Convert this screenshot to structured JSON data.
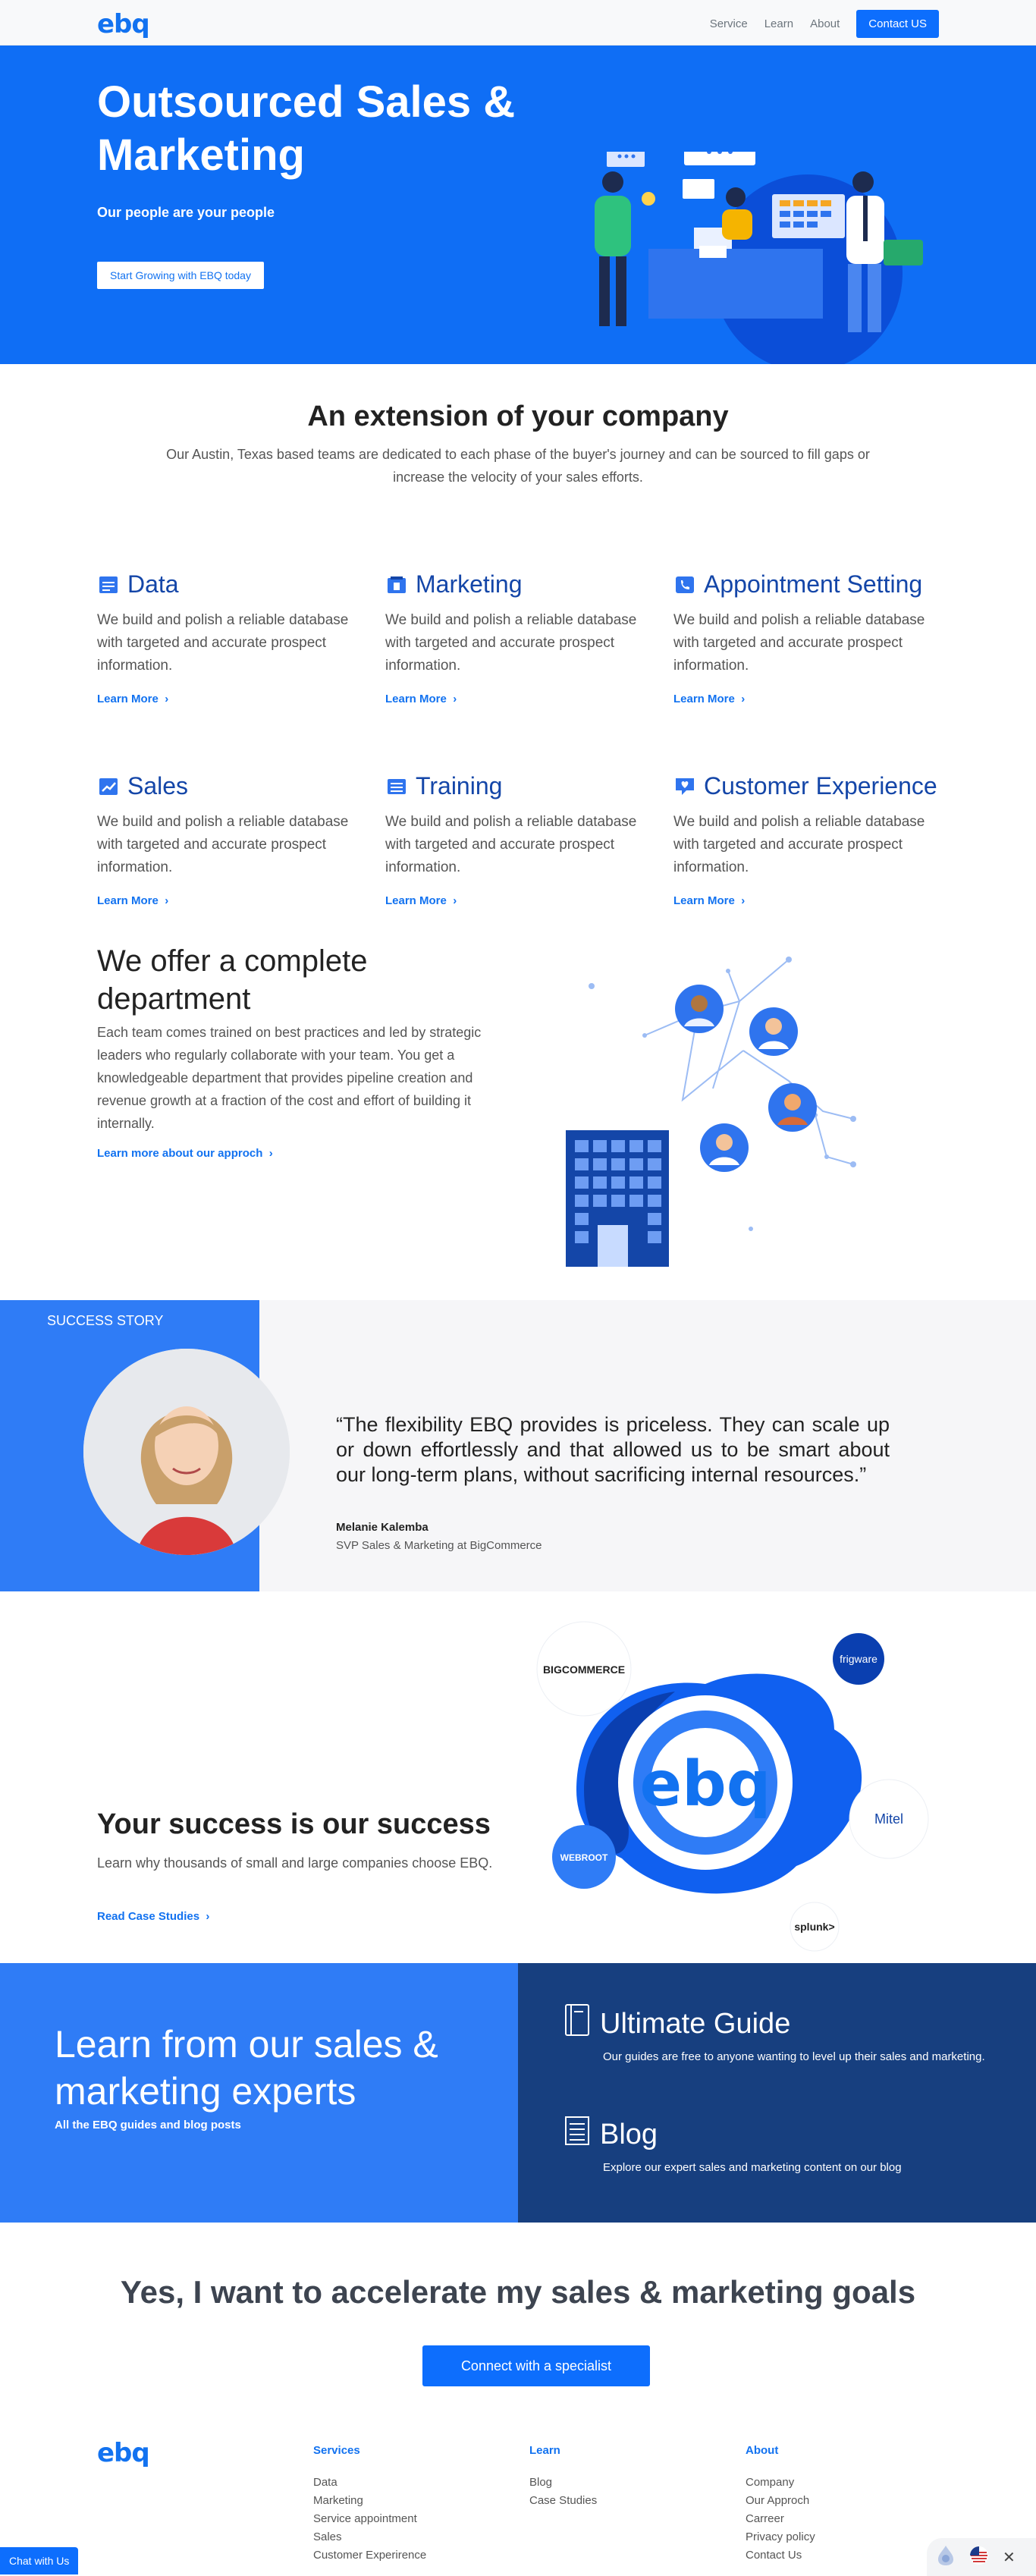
{
  "header": {
    "logo": "ebq",
    "nav": [
      "Service",
      "Learn",
      "About"
    ],
    "contact": "Contact US"
  },
  "hero": {
    "title": "Outsourced Sales & Marketing",
    "subtitle": "Our people are your people",
    "cta": "Start Growing with EBQ today"
  },
  "extension": {
    "title": "An extension of your company",
    "text": "Our Austin, Texas based teams are dedicated to each phase of the buyer's journey and can be sourced to fill gaps or increase the velocity of your sales efforts."
  },
  "services": [
    {
      "icon": "database-icon",
      "title": "Data",
      "text": "We build and polish a reliable database with targeted and accurate prospect information.",
      "link": "Learn More"
    },
    {
      "icon": "marketing-icon",
      "title": "Marketing",
      "text": "We build and polish a reliable database with targeted and accurate prospect information.",
      "link": "Learn More"
    },
    {
      "icon": "phone-icon",
      "title": "Appointment Setting",
      "text": "We build and polish a reliable database with targeted and accurate prospect information.",
      "link": "Learn More"
    },
    {
      "icon": "chart-icon",
      "title": "Sales",
      "text": "We build and polish a reliable database with targeted and accurate prospect information.",
      "link": "Learn More"
    },
    {
      "icon": "training-icon",
      "title": "Training",
      "text": "We build and polish a reliable database with targeted and accurate prospect information.",
      "link": "Learn More"
    },
    {
      "icon": "heart-chat-icon",
      "title": "Customer Experience",
      "text": "We build and polish a reliable database with targeted and accurate prospect information.",
      "link": "Learn More"
    }
  ],
  "department": {
    "title": "We offer a complete department",
    "text": "Each team comes trained on best practices and led by strategic leaders who regularly collaborate with your team. You get a knowledgeable department that provides pipeline creation and revenue growth at a fraction of the cost and effort of building it internally.",
    "link": "Learn more about our approch"
  },
  "story": {
    "label": "SUCCESS STORY",
    "quote": "“The flexibility EBQ provides is priceless. They can scale up or down effortlessly and that allowed us to be smart about our long-term plans, without sacrificing internal resources.”",
    "name": "Melanie Kalemba",
    "role": "SVP Sales & Marketing at BigCommerce"
  },
  "success": {
    "title": "Your success is our success",
    "text": "Learn why thousands of small and large companies choose EBQ.",
    "link": "Read Case Studies",
    "logos": [
      "BIGCOMMERCE",
      "frigware",
      "Mitel",
      "WEBROOT",
      "splunk>"
    ],
    "center": "ebq"
  },
  "learn": {
    "title": "Learn from our sales & marketing experts",
    "subtitle": "All the EBQ guides and blog posts",
    "guide": {
      "title": "Ultimate Guide",
      "text": "Our guides are free to anyone wanting to level up their sales and marketing."
    },
    "blog": {
      "title": "Blog",
      "text": "Explore our expert sales and marketing content on our blog"
    }
  },
  "accelerate": {
    "title": "Yes, I want to accelerate my sales & marketing goals",
    "button": "Connect with a specialist"
  },
  "footer": {
    "logo": "ebq",
    "services": {
      "head": "Services",
      "links": [
        "Data",
        "Marketing",
        "Service appointment",
        "Sales",
        "Customer Experirence"
      ]
    },
    "learn": {
      "head": "Learn",
      "links": [
        "Blog",
        "Case Studies"
      ]
    },
    "about": {
      "head": "About",
      "links": [
        "Company",
        "Our Approch",
        "Carreer",
        "Privacy policy",
        "Contact Us"
      ]
    }
  },
  "chat": "Chat with Us",
  "colors": {
    "primary": "#0f6ef5",
    "dark_blue": "#173f7f",
    "heading_blue": "#1446a8"
  }
}
